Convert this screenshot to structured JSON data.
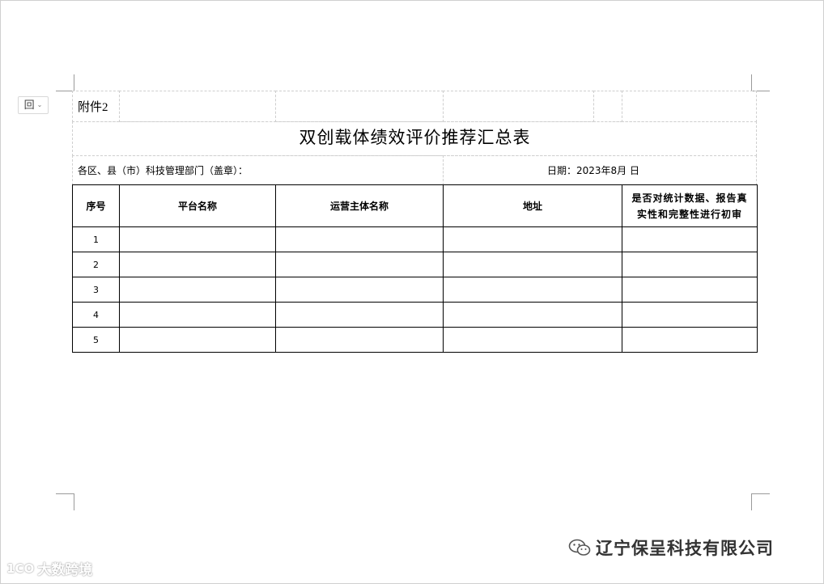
{
  "attachment_label": "附件2",
  "form_title": "双创载体绩效评价推荐汇总表",
  "region_label": "各区、县（市）科技管理部门（盖章）：",
  "date_label": "日期：2023年8月 日",
  "table": {
    "headers": {
      "seq": "序号",
      "platform_name": "平台名称",
      "operator_name": "运营主体名称",
      "address": "地址",
      "review_line1": "是否对统计数据、报告真",
      "review_line2": "实性和完整性进行初审"
    },
    "rows": [
      "1",
      "2",
      "3",
      "4",
      "5"
    ]
  },
  "watermarks": {
    "company": "辽宁保呈科技有限公司",
    "source_logo": "1CO",
    "source_name": "大数跨境"
  },
  "icons": {
    "layout_options": "layout-options-icon",
    "dropdown": "chevron-down-icon",
    "wechat": "wechat-icon"
  }
}
